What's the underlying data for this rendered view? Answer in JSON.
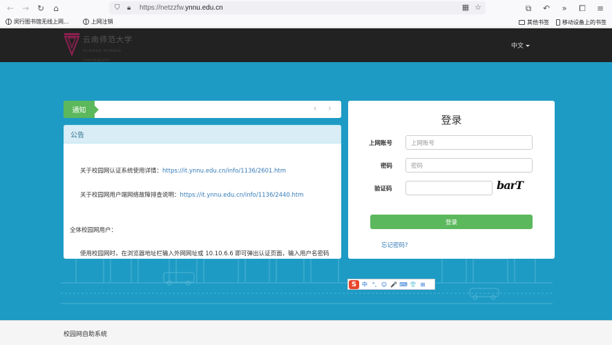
{
  "browser": {
    "url_host": "https://netzzfw.",
    "url_domain": "ynnu.edu.cn",
    "bookmarks": [
      "闵行图书馆无线上网...",
      "上网注销"
    ],
    "bookmarks_right": [
      "其他书签",
      "移动设备上的书签"
    ]
  },
  "header": {
    "logo_text": "云南师范大学",
    "logo_subtext": "YUNNAN NORMAL UNIVERSITY",
    "language": "中文"
  },
  "notice": {
    "tab_label": "通知",
    "arrows": "‹ ›"
  },
  "announcement": {
    "heading": "公告",
    "line1_text": "关于校园网认证系统使用详情：",
    "line1_link": "https://it.ynnu.edu.cn/info/1136/2601.htm",
    "line2_text": "关于校园网用户端网络故障排查说明：",
    "line2_link": "https://it.ynnu.edu.cn/info/1136/2440.htm",
    "line3_text": "全体校园网用户：",
    "line4_text": "使用校园网时，在浏览器地址栏输入外网网址或 10.10.6.6 即可弹出认证页面，输入用户名密码"
  },
  "login": {
    "title": "登录",
    "account_label": "上网账号",
    "account_placeholder": "上网账号",
    "password_label": "密码",
    "password_placeholder": "密码",
    "captcha_label": "验证码",
    "captcha_text": "barT",
    "submit_label": "登录",
    "forgot_label": "忘记密码?"
  },
  "ime": {
    "logo": "S",
    "items": [
      "中",
      "°,",
      "☺",
      "🎤",
      "⌨",
      "👕",
      "⊞"
    ]
  },
  "footer": {
    "text": "校园网自助系统"
  },
  "colors": {
    "main_bg": "#1e9bc4",
    "header_bg": "#222222",
    "accent_green": "#5cb85c",
    "link_blue": "#337ab7"
  }
}
